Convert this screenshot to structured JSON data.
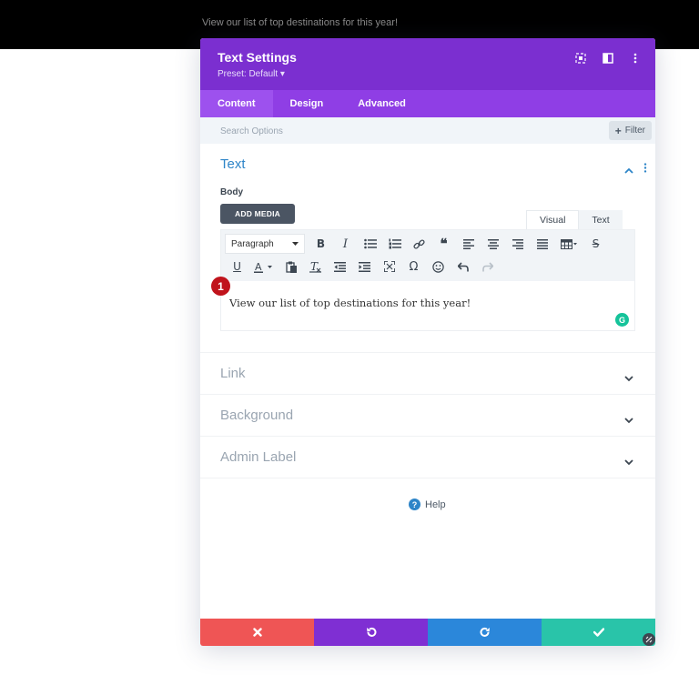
{
  "page": {
    "preview_text": "View our list of top destinations for this year!"
  },
  "modal": {
    "title": "Text Settings",
    "preset": "Preset: Default ▾",
    "header_icons": [
      "expand-icon",
      "sidebar-toggle-icon",
      "kebab-menu-icon"
    ],
    "tabs": [
      {
        "label": "Content",
        "active": true
      },
      {
        "label": "Design"
      },
      {
        "label": "Advanced"
      }
    ],
    "search": {
      "placeholder": "Search Options"
    },
    "filter": {
      "label": "Filter"
    }
  },
  "text_section": {
    "title": "Text",
    "body_label": "Body",
    "add_media_label": "ADD MEDIA",
    "editor_modes": {
      "visual": "Visual",
      "text": "Text"
    },
    "paragraph_select": "Paragraph",
    "content": "View our list of top destinations for this year!",
    "step_number": "1",
    "grammarly_badge": "G"
  },
  "accordions": [
    {
      "title": "Link"
    },
    {
      "title": "Background"
    },
    {
      "title": "Admin Label"
    }
  ],
  "help": {
    "icon_glyph": "?",
    "label": "Help"
  },
  "footer": {
    "buttons": [
      "cancel",
      "undo",
      "redo",
      "save"
    ]
  },
  "colors": {
    "header_purple": "#7b2fd0",
    "tab_purple": "#8f3ee5",
    "section_blue": "#2e85c8",
    "cancel_red": "#ef5555",
    "undo_purple": "#7f2fd3",
    "redo_blue": "#2b87da",
    "save_teal": "#29c4a9"
  }
}
